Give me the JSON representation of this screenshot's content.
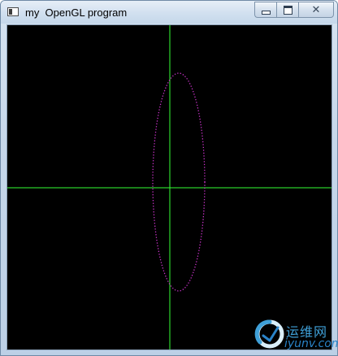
{
  "window": {
    "title": "my  OpenGL program",
    "caption_buttons": {
      "minimize_icon": "minimize-icon",
      "maximize_icon": "maximize-icon",
      "close_icon": "close-icon",
      "close_glyph": "✕"
    }
  },
  "canvas": {
    "background": "#000000",
    "axis_color": "#33ff33",
    "ellipse_color": "#cc33cc",
    "ellipse_style": "dotted"
  },
  "watermark": {
    "cn_text": "运维网",
    "en_text": "iyunv.com"
  }
}
